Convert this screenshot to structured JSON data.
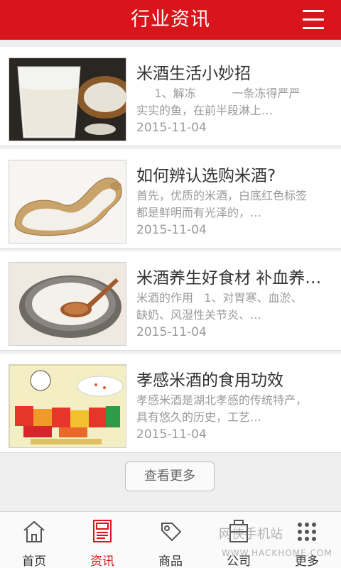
{
  "header": {
    "title": "行业资讯",
    "menu_icon": "hamburger-menu-icon",
    "bg_color": "#d9141b"
  },
  "articles": [
    {
      "title": "米酒生活小妙招",
      "desc": "     1、解冻          一条冻得严严实实的鱼，在前半段淋上…",
      "date": "2015-11-04"
    },
    {
      "title": "如何辨认选购米酒?",
      "desc": "首先，优质的米酒，白底红色标签都是鲜明而有光泽的，…",
      "date": "2015-11-04"
    },
    {
      "title": "米酒养生好食材 补血养…",
      "desc": "米酒的作用   1、对胃寒、血淤、缺奶、风湿性关节炎、…",
      "date": "2015-11-04"
    },
    {
      "title": "孝感米酒的食用功效",
      "desc": "孝感米酒是湖北孝感的传统特产，具有悠久的历史，工艺…",
      "date": "2015-11-04"
    }
  ],
  "more_button": "查看更多",
  "tabs": [
    {
      "label": "首页",
      "icon": "home-icon"
    },
    {
      "label": "资讯",
      "icon": "news-icon",
      "active": true
    },
    {
      "label": "商品",
      "icon": "tag-icon"
    },
    {
      "label": "公司",
      "icon": "company-icon"
    },
    {
      "label": "更多",
      "icon": "more-icon"
    }
  ],
  "watermark": {
    "text": "网侠手机站",
    "url_text": "WWW.HACKHOME.COM"
  }
}
